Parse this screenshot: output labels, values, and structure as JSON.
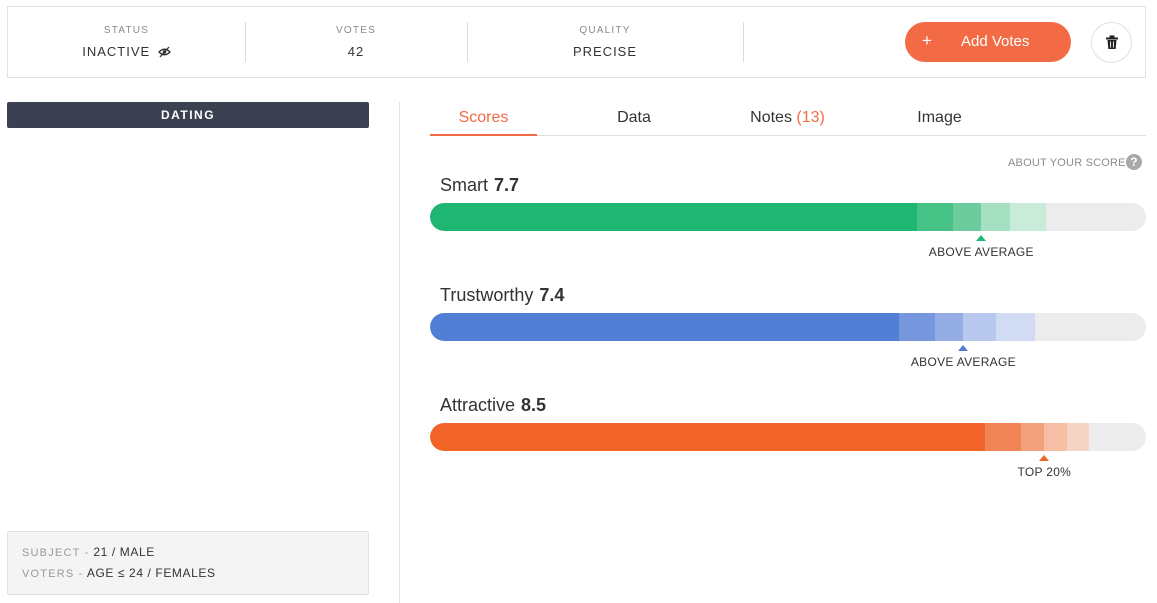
{
  "header": {
    "status": {
      "label": "STATUS",
      "value": "INACTIVE",
      "icon": "eye-off-icon"
    },
    "votes": {
      "label": "VOTES",
      "value": "42"
    },
    "quality": {
      "label": "QUALITY",
      "value": "PRECISE"
    },
    "add_votes": {
      "plus": "+",
      "label": "Add Votes"
    },
    "delete_icon": "trash-icon",
    "accent_color": "#f26b45"
  },
  "sidebar": {
    "category": "DATING",
    "subject": {
      "key": "SUBJECT -",
      "value": "21 / MALE"
    },
    "voters": {
      "key": "VOTERS -",
      "value": "AGE ≤ 24 / FEMALES"
    }
  },
  "tabs": {
    "scores": "Scores",
    "data": "Data",
    "notes": "Notes",
    "notes_count": "(13)",
    "image": "Image",
    "active": "Scores"
  },
  "about_scores": {
    "label": "ABOUT YOUR SCORES",
    "icon": "?"
  },
  "scores": [
    {
      "name": "Smart",
      "value": "7.7",
      "rating": "ABOVE AVERAGE",
      "color": "#1fb572",
      "level": 0.68,
      "bands": [
        0.05,
        0.04,
        0.04,
        0.05
      ],
      "band_colors": [
        "#47c287",
        "#6ccc9e",
        "#a5e0c3",
        "#c8ecd9"
      ]
    },
    {
      "name": "Trustworthy",
      "value": "7.4",
      "rating": "ABOVE AVERAGE",
      "color": "#527fd6",
      "level": 0.655,
      "bands": [
        0.05,
        0.04,
        0.045,
        0.055
      ],
      "band_colors": [
        "#7696de",
        "#95ade5",
        "#b8c8ee",
        "#d1dbf3"
      ]
    },
    {
      "name": "Attractive",
      "value": "8.5",
      "rating": "TOP 20%",
      "color": "#f06527",
      "level": 0.775,
      "bands": [
        0.05,
        0.033,
        0.032,
        0.03
      ],
      "band_colors": [
        "#f08455",
        "#f3a07c",
        "#f5bea5",
        "#f6d4c5"
      ]
    }
  ]
}
